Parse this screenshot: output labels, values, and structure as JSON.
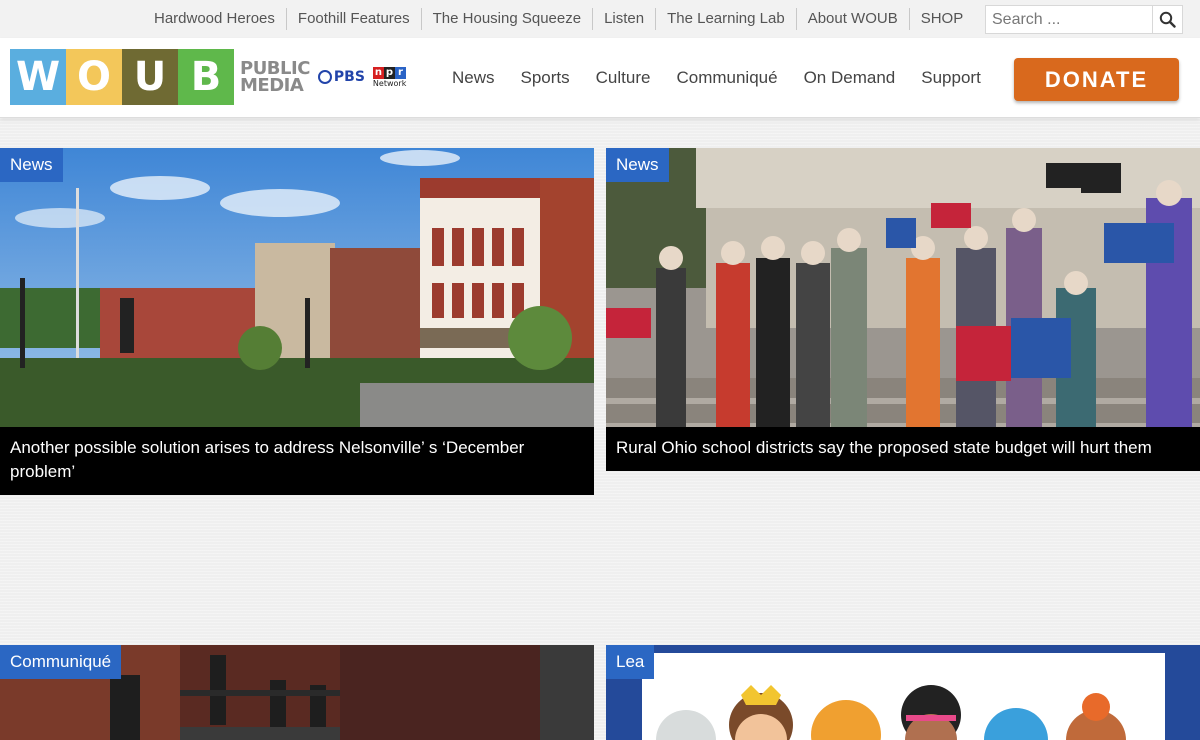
{
  "topbar": {
    "links": [
      "Hardwood Heroes",
      "Foothill Features",
      "The Housing Squeeze",
      "Listen",
      "The Learning Lab",
      "About WOUB",
      "SHOP"
    ],
    "search_placeholder": "Search ..."
  },
  "header": {
    "logo_letters": [
      "W",
      "O",
      "U",
      "B"
    ],
    "logo_colors": [
      "#5aaedf",
      "#f3c75a",
      "#6f6a33",
      "#5fb84b"
    ],
    "logo_tagline_1": "PUBLIC",
    "logo_tagline_2": "MEDIA",
    "pbs_label": "PBS",
    "npr_letters": [
      "n",
      "p",
      "r"
    ],
    "npr_sub": "Network",
    "nav": [
      "News",
      "Sports",
      "Culture",
      "Communiqué",
      "On Demand",
      "Support"
    ],
    "donate_label": "DONATE",
    "donate_color": "#d9691d"
  },
  "cards": [
    {
      "tag": "News",
      "caption": "Another possible solution arises to address Nelsonville’ s ‘December problem’"
    },
    {
      "tag": "News",
      "caption": "Rural Ohio school districts say the proposed state budget will hurt them"
    },
    {
      "tag": "Communiqué",
      "caption": ""
    },
    {
      "tag": "Lea",
      "caption": ""
    }
  ],
  "images": {
    "card1": "street with historic brick buildings, fountain and flowerbeds under blue sky",
    "card2": "crowd holding public school signs on courthouse steps",
    "card3": "dark theatre stage with performers",
    "card4": "illustrated cartoon children characters"
  },
  "colors": {
    "tag_blue": "#2b67c3",
    "caption_bg": "#000000"
  }
}
